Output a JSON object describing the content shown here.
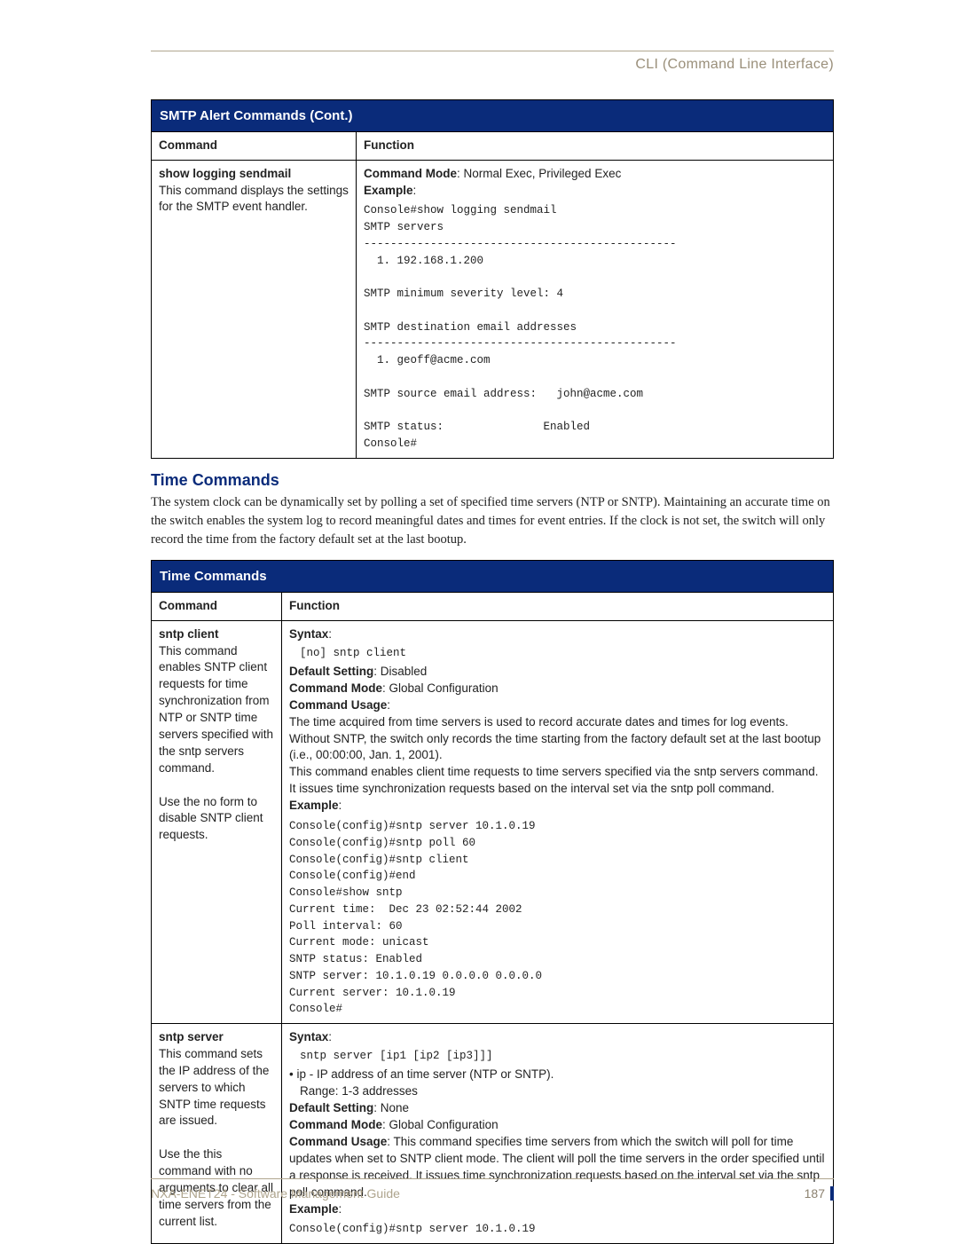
{
  "header": {
    "title": "CLI (Command Line Interface)"
  },
  "table1": {
    "title": "SMTP Alert Commands (Cont.)",
    "col1": "Command",
    "col2": "Function",
    "row": {
      "cmd_name": "show logging sendmail",
      "cmd_desc": "This command displays the settings for the SMTP event handler.",
      "mode_label": "Command Mode",
      "mode_value": ": Normal Exec, Privileged Exec",
      "example_label": "Example",
      "example_code": "Console#show logging sendmail\nSMTP servers\n-----------------------------------------------\n  1. 192.168.1.200\n\nSMTP minimum severity level: 4\n\nSMTP destination email addresses\n-----------------------------------------------\n  1. geoff@acme.com\n\nSMTP source email address:   john@acme.com\n\nSMTP status:               Enabled\nConsole#"
    }
  },
  "section": {
    "heading": "Time Commands",
    "paragraph": "The system clock can be dynamically set by polling a set of specified time servers (NTP or SNTP). Maintaining an accurate time on the switch enables the system log to record meaningful dates and times for event entries. If the clock is not set, the switch will only record the time from the factory default set at the last bootup."
  },
  "table2": {
    "title": "Time Commands",
    "col1": "Command",
    "col2": "Function",
    "row1": {
      "cmd_name": "sntp client",
      "cmd_desc_p1": "This command enables SNTP client requests for time synchronization from NTP or SNTP time servers specified with the sntp servers command.",
      "cmd_desc_p2": "Use the no form to disable SNTP client requests.",
      "syntax_label": "Syntax",
      "syntax_code": "[no] sntp client",
      "default_label": "Default Setting",
      "default_value": ": Disabled",
      "mode_label": "Command Mode",
      "mode_value": ": Global Configuration",
      "usage_label": "Command Usage",
      "usage_p1": "The time acquired from time servers is used to record accurate dates and times for log events. Without SNTP, the switch only records the time starting from the factory default set at the last bootup (i.e., 00:00:00, Jan. 1, 2001).",
      "usage_p2": "This command enables client time requests to time servers specified via the sntp servers command. It issues time synchronization requests based on the interval set via the sntp poll command.",
      "example_label": "Example",
      "example_code": "Console(config)#sntp server 10.1.0.19\nConsole(config)#sntp poll 60\nConsole(config)#sntp client\nConsole(config)#end\nConsole#show sntp\nCurrent time:  Dec 23 02:52:44 2002\nPoll interval: 60\nCurrent mode: unicast\nSNTP status: Enabled\nSNTP server: 10.1.0.19 0.0.0.0 0.0.0.0\nCurrent server: 10.1.0.19\nConsole#"
    },
    "row2": {
      "cmd_name": "sntp server",
      "cmd_desc_p1": "This command sets the IP address of the servers to which SNTP time requests are issued.",
      "cmd_desc_p2": "Use the this command with no arguments to clear all time servers from the current list.",
      "syntax_label": "Syntax",
      "syntax_code": "sntp server [ip1 [ip2 [ip3]]]",
      "ip_note": "• ip - IP address of an time server (NTP or SNTP).",
      "ip_range": "Range: 1-3 addresses",
      "default_label": "Default Setting",
      "default_value": ": None",
      "mode_label": "Command Mode",
      "mode_value": ": Global Configuration",
      "usage_label": "Command Usage",
      "usage_text": ": This command specifies time servers from which the switch will poll for time updates when set to SNTP client mode. The client will poll the time servers in the order specified until a response is received. It issues time synchronization requests based on the interval set via the sntp poll command.",
      "example_label": "Example",
      "example_code": "Console(config)#sntp server 10.1.0.19"
    }
  },
  "footer": {
    "doc_title": "NXA-ENET24 - Software Management Guide",
    "page_num": "187"
  }
}
